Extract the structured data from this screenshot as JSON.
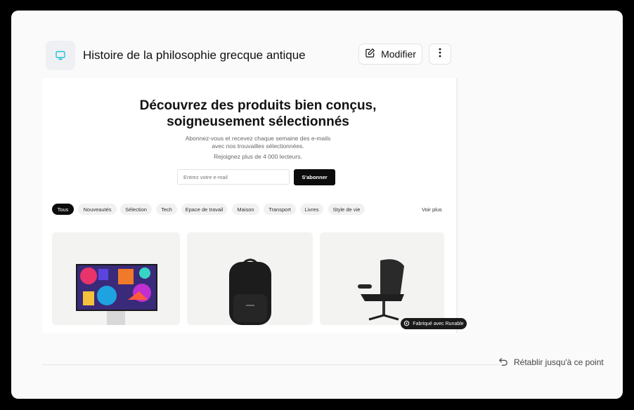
{
  "header": {
    "title": "Histoire de la philosophie grecque antique",
    "modify_label": "Modifier",
    "accent_color": "#22c4d8"
  },
  "preview": {
    "hero_line1": "Découvrez des produits bien conçus,",
    "hero_line2": "soigneusement sélectionnés",
    "sub_line1": "Abonnez-vous et recevez chaque semaine des e-mails",
    "sub_line2": "avec nos trouvailles sélectionnées.",
    "readers": "Rejoignez plus de 4 000 lecteurs.",
    "email_placeholder": "Entrez votre e-mail",
    "subscribe_label": "S'abonner",
    "filters": [
      "Tous",
      "Nouveautés",
      "Sélection",
      "Tech",
      "Epace de travail",
      "Maison",
      "Transport",
      "Livres",
      "Style de vie"
    ],
    "see_more": "Voir plus",
    "badge": "Fabriqué avec Runable"
  },
  "footer": {
    "restore_label": "Rétablir jusqu'à ce point"
  }
}
